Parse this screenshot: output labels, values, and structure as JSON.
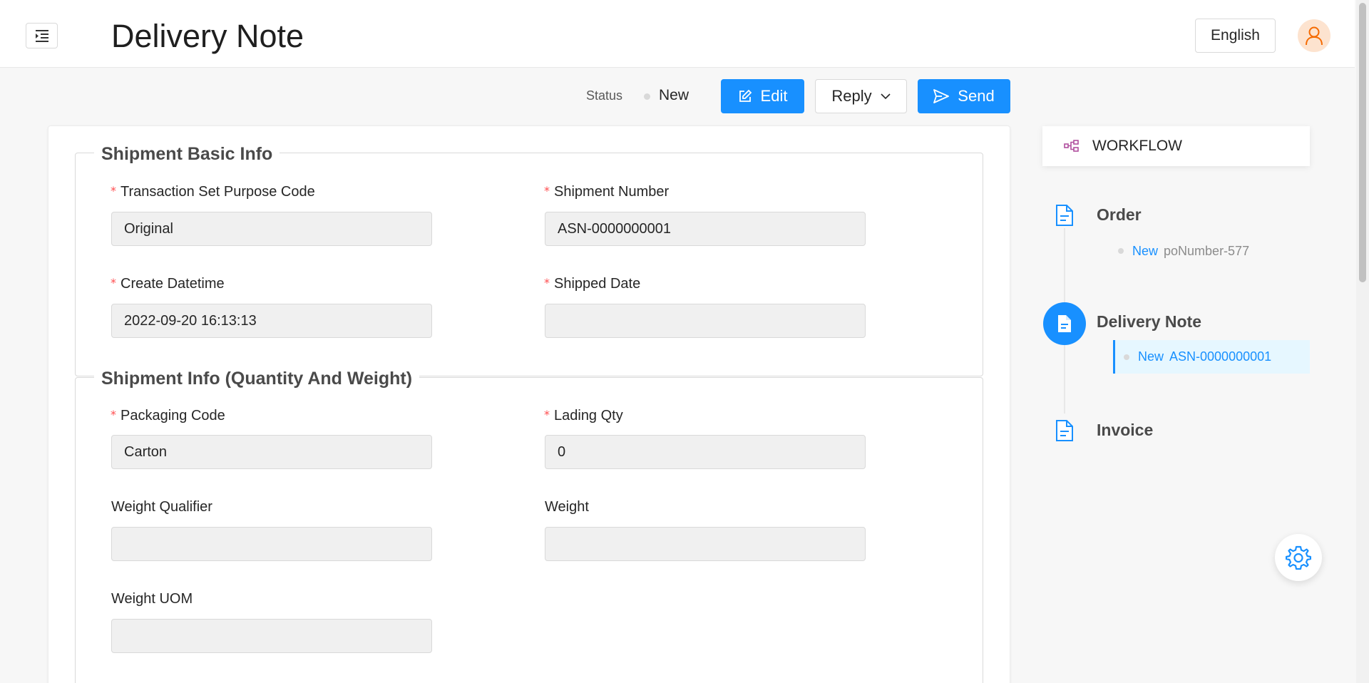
{
  "header": {
    "title": "Delivery Note",
    "language": "English"
  },
  "actions": {
    "status_label": "Status",
    "status_value": "New",
    "edit_label": "Edit",
    "reply_label": "Reply",
    "send_label": "Send"
  },
  "sections": [
    {
      "title": "Shipment Basic Info",
      "fields": [
        {
          "label": "Transaction Set Purpose Code",
          "value": "Original",
          "required": true
        },
        {
          "label": "Shipment Number",
          "value": "ASN-0000000001",
          "required": true
        },
        {
          "label": "Create Datetime",
          "value": "2022-09-20 16:13:13",
          "required": true
        },
        {
          "label": "Shipped Date",
          "value": "",
          "required": true
        }
      ]
    },
    {
      "title": "Shipment Info (Quantity And Weight)",
      "fields": [
        {
          "label": "Packaging Code",
          "value": "Carton",
          "required": true
        },
        {
          "label": "Lading Qty",
          "value": "0",
          "required": true
        },
        {
          "label": "Weight Qualifier",
          "value": "",
          "required": false
        },
        {
          "label": "Weight",
          "value": "",
          "required": false
        },
        {
          "label": "Weight UOM",
          "value": "",
          "required": false
        }
      ]
    }
  ],
  "workflow": {
    "title": "WORKFLOW",
    "nodes": [
      {
        "title": "Order",
        "items": [
          {
            "status": "New",
            "number": "poNumber-577"
          }
        ]
      },
      {
        "title": "Delivery Note",
        "active": true,
        "items": [
          {
            "status": "New",
            "number": "ASN-0000000001"
          }
        ]
      },
      {
        "title": "Invoice",
        "items": []
      }
    ]
  },
  "colors": {
    "primary": "#1890ff",
    "required": "#ff4d4f",
    "avatar_bg": "#fde3cf",
    "avatar_icon": "#f56a00",
    "workflow_icon": "#b04f9e"
  }
}
